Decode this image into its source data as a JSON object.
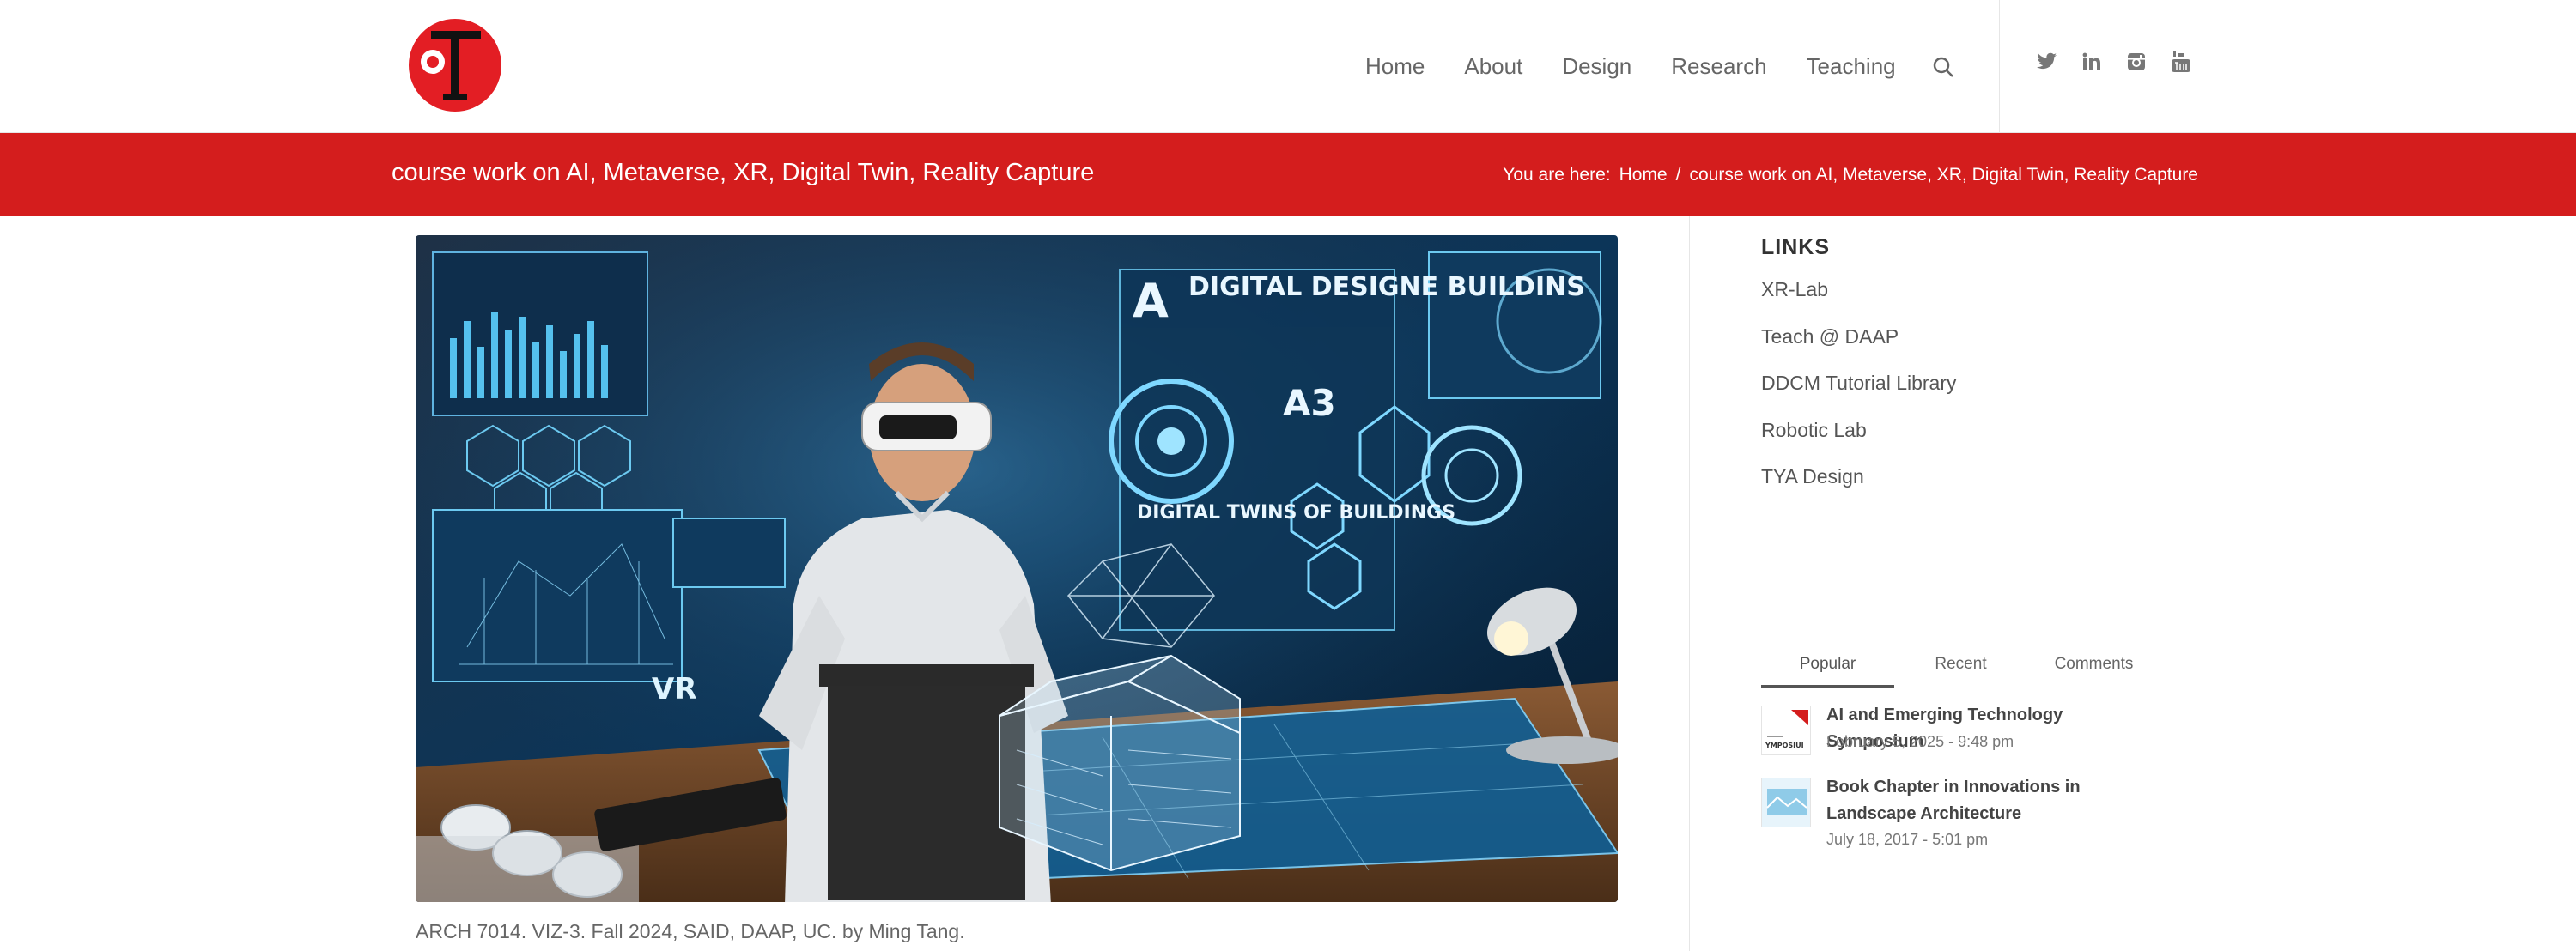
{
  "nav": {
    "items": [
      "Home",
      "About",
      "Design",
      "Research",
      "Teaching"
    ],
    "search_icon": "search-icon"
  },
  "social": [
    "twitter-icon",
    "linkedin-icon",
    "instagram-icon",
    "youtube-icon"
  ],
  "titlebar": {
    "title": "course work on AI, Metaverse, XR, Digital Twin, Reality Capture",
    "breadcrumb_prefix": "You are here:",
    "breadcrumb_home": "Home",
    "breadcrumb_sep": "/",
    "breadcrumb_current": "course work on AI, Metaverse, XR, Digital Twin, Reality Capture"
  },
  "hero": {
    "text_digital_design": "DIGITAL DESIGNE BUILDINS",
    "text_digital_twins": "DIGITAL TWINS OF BUILDINGS",
    "text_vr": "VR",
    "text_a3": "A3",
    "text_a": "A"
  },
  "caption": "ARCH 7014. VIZ-3. Fall 2024, SAID, DAAP, UC. by Ming Tang.",
  "sidebar": {
    "links_title": "LINKS",
    "links": [
      "XR-Lab",
      "Teach @ DAAP",
      "DDCM Tutorial Library",
      "Robotic Lab",
      "TYA Design"
    ],
    "tabs": [
      "Popular",
      "Recent",
      "Comments"
    ],
    "posts": [
      {
        "title": "AI and Emerging Technology Symposium",
        "date": "February 5, 2025 - 9:48 pm",
        "thumb_text": "YMPOSIUI"
      },
      {
        "title": "Book Chapter in Innovations in Landscape Architecture",
        "date": "July 18, 2017 - 5:01 pm"
      }
    ]
  },
  "colors": {
    "brand_red": "#d41d1d",
    "nav_text": "#666666",
    "hero_blue": "#0b2a4a"
  }
}
